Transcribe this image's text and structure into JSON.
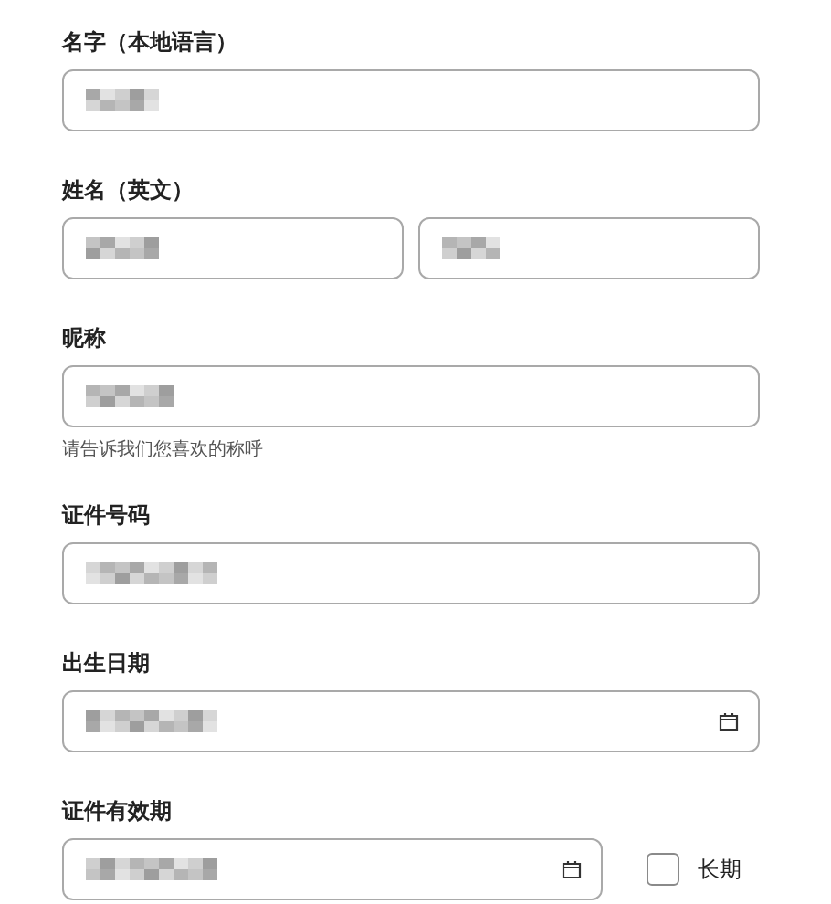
{
  "fields": [
    {
      "label": "名字（本地语言）",
      "inputs": [
        {
          "kind": "text"
        }
      ]
    },
    {
      "label": "姓名（英文）",
      "inputs": [
        {
          "kind": "text"
        },
        {
          "kind": "text"
        }
      ]
    },
    {
      "label": "昵称",
      "inputs": [
        {
          "kind": "text"
        }
      ],
      "hint": "请告诉我们您喜欢的称呼"
    },
    {
      "label": "证件号码",
      "inputs": [
        {
          "kind": "text"
        }
      ]
    },
    {
      "label": "出生日期",
      "inputs": [
        {
          "kind": "date"
        }
      ]
    },
    {
      "label": "证件有效期",
      "inputs": [
        {
          "kind": "date"
        }
      ],
      "checkbox": {
        "label": "长期",
        "checked": false
      }
    }
  ]
}
